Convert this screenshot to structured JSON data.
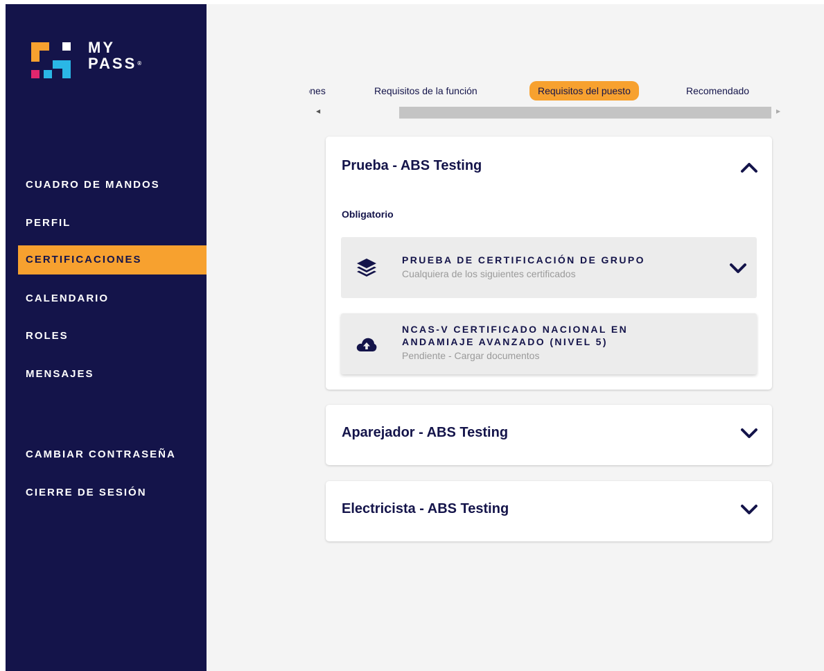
{
  "brand": {
    "line1": "MY",
    "line2": "PASS",
    "reg": "®",
    "colors": {
      "orange": "#f7a12f",
      "blue": "#2ab7e6",
      "magenta": "#e0266e",
      "navy": "#14144a"
    }
  },
  "sidebar": {
    "items": [
      {
        "label": "CUADRO DE MANDOS",
        "active": false
      },
      {
        "label": "PERFIL",
        "active": false
      },
      {
        "label": "CERTIFICACIONES",
        "active": true
      },
      {
        "label": "CALENDARIO",
        "active": false
      },
      {
        "label": "ROLES",
        "active": false
      },
      {
        "label": "MENSAJES",
        "active": false
      },
      {
        "label": "CAMBIAR CONTRASEÑA",
        "active": false
      },
      {
        "label": "CIERRE DE SESIÓN",
        "active": false
      }
    ]
  },
  "tabs": {
    "items": [
      {
        "label": "Certificaciones",
        "active": false
      },
      {
        "label": "Requisitos de la función",
        "active": false
      },
      {
        "label": "Requisitos del puesto",
        "active": true
      },
      {
        "label": "Recomendado",
        "active": false
      }
    ],
    "scroll_left_icon": "caret-left-icon",
    "scroll_right_icon": "caret-right-icon"
  },
  "cards": [
    {
      "title": "Prueba - ABS Testing",
      "expanded": true,
      "section_label": "Obligatorio",
      "certs": [
        {
          "icon": "layers-icon",
          "title": "PRUEBA DE CERTIFICACIÓN DE GRUPO",
          "subtitle": "Cualquiera de los siguientes certificados"
        },
        {
          "icon": "cloud-upload-icon",
          "title_line1": "NCAS-V CERTIFICADO NACIONAL EN",
          "title_line2": "ANDAMIAJE AVANZADO (NIVEL 5)",
          "subtitle": "Pendiente - Cargar documentos"
        }
      ]
    },
    {
      "title": "Aparejador - ABS Testing",
      "expanded": false
    },
    {
      "title": "Electricista - ABS Testing",
      "expanded": false
    }
  ],
  "colors": {
    "sidebar_bg": "#14144a",
    "accent": "#f7a12f",
    "main_bg": "#f4f4f4",
    "cert_bg": "#ececec",
    "muted_text": "#9a9a9a"
  }
}
